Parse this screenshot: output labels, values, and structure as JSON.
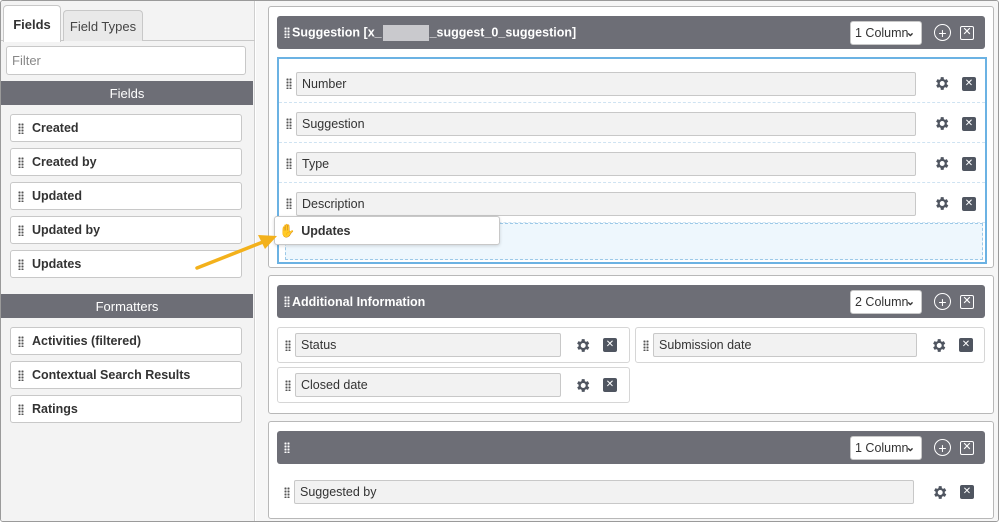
{
  "left_panel": {
    "tabs": [
      {
        "label": "Fields",
        "active": true
      },
      {
        "label": "Field Types",
        "active": false
      }
    ],
    "filter_placeholder": "Filter",
    "fields_header": "Fields",
    "fields": [
      "Created",
      "Created by",
      "Updated",
      "Updated by",
      "Updates"
    ],
    "formatters_header": "Formatters",
    "formatters": [
      "Activities (filtered)",
      "Contextual Search Results",
      "Ratings"
    ]
  },
  "sections": [
    {
      "title_prefix": "Suggestion [x_",
      "title_suffix": "_suggest_0_suggestion]",
      "columns": "1 Column",
      "fields": [
        "Number",
        "Suggestion",
        "Type",
        "Description"
      ],
      "dragging_field": "Updates"
    },
    {
      "title": "Additional Information",
      "columns": "2 Column",
      "left_fields": [
        "Status",
        "Closed date"
      ],
      "right_fields": [
        "Submission date"
      ]
    },
    {
      "title": "",
      "columns": "1 Column",
      "fields": [
        "Suggested by"
      ]
    }
  ],
  "colors": {
    "header_bg": "#6d6e76",
    "drop_zone_border": "#6bb2e3",
    "arrow": "#f3b11b"
  },
  "icons": {
    "drag": "grip-icon",
    "settings": "gear-icon",
    "remove": "close-icon",
    "add": "plus-circle-icon",
    "cursor": "grab-hand-icon",
    "arrow": "arrow-icon"
  }
}
